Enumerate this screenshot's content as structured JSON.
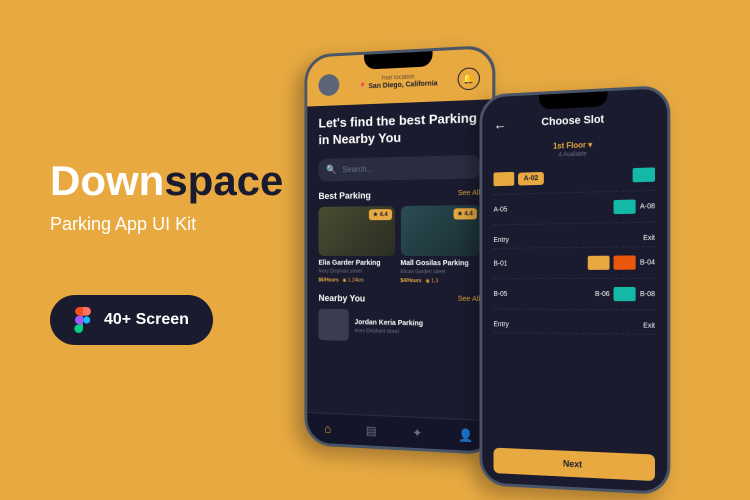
{
  "brand": {
    "word1": "Down",
    "word2": "space"
  },
  "subtitle": "Parking App UI Kit",
  "badge": "40+ Screen",
  "phone1": {
    "location_label": "Your location",
    "location_value": "📍 San Diego, California",
    "hero": "Let's find the best Parking in Nearby You",
    "search_placeholder": "Search...",
    "best_parking": {
      "title": "Best Parking",
      "see_all": "See All"
    },
    "cards": [
      {
        "rating": "★ 4.4",
        "title": "Elia Garder Parking",
        "sub": "Ivory Elephant street",
        "price": "$6/Hours",
        "dist": "◉ 1.24km"
      },
      {
        "rating": "★ 4.4",
        "title": "Mall Gosilas Parking",
        "sub": "Elican Garden street",
        "price": "$4/Hours",
        "dist": "◉ 1.3"
      }
    ],
    "nearby": {
      "title": "Nearby You",
      "see_all": "See All",
      "item_title": "Jordan Keria Parking",
      "item_sub": "Ivory Elephant street"
    }
  },
  "phone2": {
    "title": "Choose Slot",
    "floor": "1st Floor ▾",
    "available": "4 Available",
    "slots_top": [
      {
        "label": "A-02",
        "selected": true
      },
      {
        "label": "A-05"
      },
      {
        "label": "A-08"
      }
    ],
    "entry": "Entry",
    "exit": "Exit",
    "slots_b1": [
      {
        "label": "B-01"
      },
      {
        "label": "B-04"
      }
    ],
    "slots_b2": [
      {
        "label": "B-05"
      },
      {
        "label": "B-06"
      },
      {
        "label": "B-08"
      }
    ],
    "next": "Next"
  }
}
